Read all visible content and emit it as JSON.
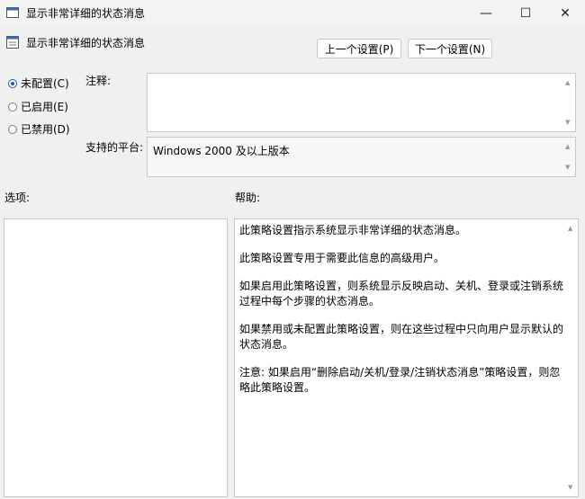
{
  "window": {
    "title": "显示非常详细的状态消息",
    "min_glyph": "—",
    "max_glyph": "☐",
    "close_glyph": "✕"
  },
  "header": {
    "title": "显示非常详细的状态消息",
    "prev_label": "上一个设置(P)",
    "next_label": "下一个设置(N)"
  },
  "radios": [
    {
      "label": "未配置(C)",
      "checked": true
    },
    {
      "label": "已启用(E)",
      "checked": false
    },
    {
      "label": "已禁用(D)",
      "checked": false
    }
  ],
  "comment": {
    "label": "注释:",
    "value": ""
  },
  "platform": {
    "label": "支持的平台:",
    "value": "Windows 2000 及以上版本"
  },
  "options_label": "选项:",
  "help_label": "帮助:",
  "help_paragraphs": [
    "此策略设置指示系统显示非常详细的状态消息。",
    "此策略设置专用于需要此信息的高级用户。",
    "如果启用此策略设置，则系统显示反映启动、关机、登录或注销系统过程中每个步骤的状态消息。",
    "如果禁用或未配置此策略设置，则在这些过程中只向用户显示默认的状态消息。",
    "注意: 如果启用“删除启动/关机/登录/注销状态消息”策略设置，则忽略此策略设置。"
  ],
  "scroll_up_glyph": "▲",
  "scroll_down_glyph": "▼",
  "colors": {
    "background": "#f0f0f0",
    "accent": "#1a5fb4"
  }
}
